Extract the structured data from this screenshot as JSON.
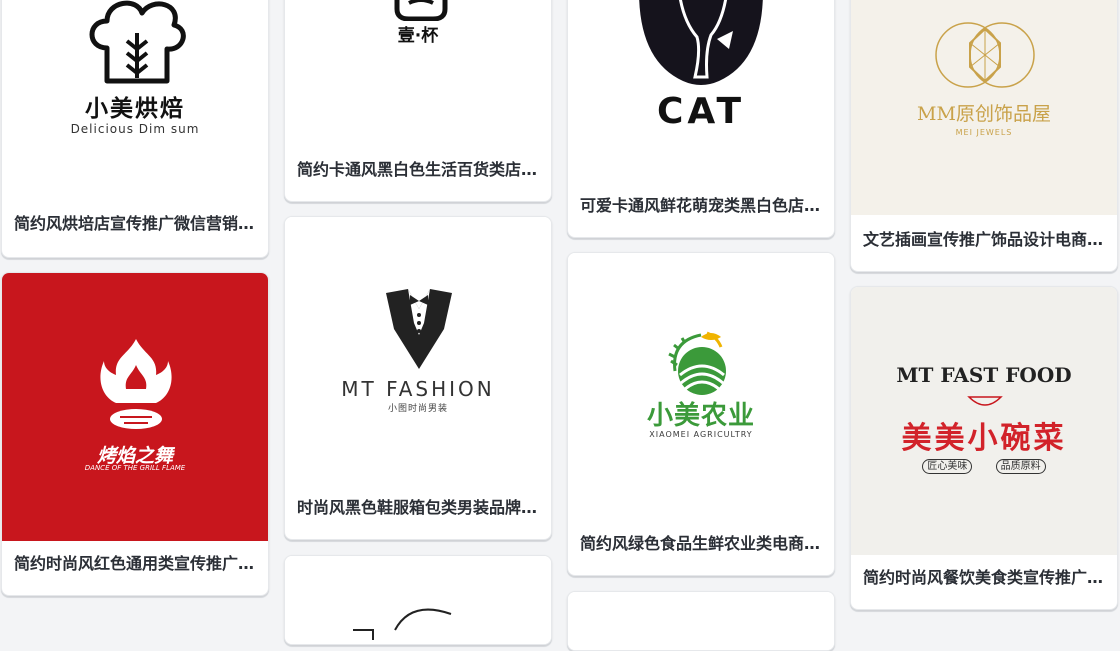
{
  "cards": [
    {
      "title": "简约风烘培店宣传推广微信营销电商店铺logo",
      "logo": {
        "name": "小美烘焙",
        "tagline": "Delicious Dim sum",
        "icon": "chef-hat-icon"
      }
    },
    {
      "title": "简约时尚风红色通用类宣传推广烧烤店logo",
      "logo": {
        "name": "烤焰之舞",
        "tagline": "DANCE OF THE GRILL FLAME",
        "icon": "flame-steak-icon",
        "bg": "#c8161d"
      }
    },
    {
      "title": "简约卡通风黑白色生活百货类店铺logo",
      "logo": {
        "name": "壹·杯",
        "icon": "cup-icon"
      }
    },
    {
      "title": "时尚风黑色鞋服箱包类男装品牌logo",
      "logo": {
        "name": "MT FASHION",
        "tagline": "小图时尚男装",
        "icon": "tuxedo-icon"
      }
    },
    {
      "title": "可爱卡通风鲜花萌宠类黑白色店铺logo",
      "logo": {
        "name": "CAT",
        "icon": "cat-silhouette-icon"
      }
    },
    {
      "title": "简约风绿色食品生鲜农业类电商店铺logo",
      "logo": {
        "name": "小美农业",
        "tagline": "XIAOMEI AGRICULTRY",
        "icon": "farm-field-icon"
      }
    },
    {
      "title": "文艺插画宣传推广饰品设计电商店铺logo",
      "logo": {
        "name": "MM原创饰品屋",
        "tagline": "MEI JEWELS",
        "icon": "diamond-icon",
        "bg": "#f4f1ea"
      }
    },
    {
      "title": "简约时尚风餐饮美食类宣传推广店铺logo",
      "logo": {
        "name": "美美小碗菜",
        "top": "MT FAST FOOD",
        "tags": [
          "匠心美味",
          "品质原料"
        ],
        "icon": "bowl-icon",
        "bg": "#f1f0ec"
      }
    }
  ],
  "colors": {
    "red": "#c8161d",
    "gold": "#c9a24a",
    "green": "#3b9a3a",
    "text": "#2b2f36"
  }
}
